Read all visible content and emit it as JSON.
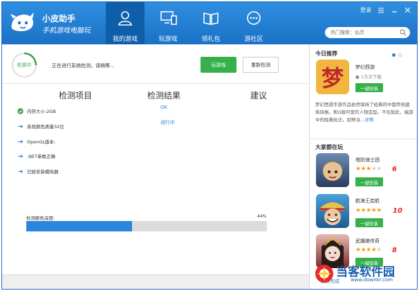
{
  "header": {
    "brand_name": "小皮助手",
    "brand_slogan": "手机游戏电脑玩",
    "nav": [
      {
        "label": "我的游戏",
        "icon": "user-icon",
        "active": true
      },
      {
        "label": "玩游戏",
        "icon": "monitor-phone-icon",
        "active": false
      },
      {
        "label": "领礼包",
        "icon": "book-icon",
        "active": false
      },
      {
        "label": "游社区",
        "icon": "chat-bubble-icon",
        "active": false
      }
    ],
    "login_label": "登录",
    "search_placeholder": "热门搜索：仙灵",
    "colors": {
      "header_bg": "#1a71c6",
      "active_tab": "#0f5ea9"
    }
  },
  "check": {
    "status_label": "检测中",
    "status_message": "正在进行系统检测，请稍等...",
    "play_button": "玩游戏",
    "recheck_button": "重新检测",
    "columns": [
      "检测项目",
      "检测结果",
      "建议"
    ],
    "items": [
      {
        "label": "内存大小:2GB",
        "state": "done",
        "result": "OK"
      },
      {
        "label": "系统颜色质量32位",
        "state": "pending",
        "result": "进行中"
      },
      {
        "label": "OpenGL版本:",
        "state": "pending",
        "result": ""
      },
      {
        "label": ".NET参数正确",
        "state": "pending",
        "result": ""
      },
      {
        "label": "已经安装模拟器",
        "state": "pending",
        "result": ""
      }
    ],
    "progress_label": "检测颜色深度:",
    "progress_text": "44%",
    "progress_value": 0.44,
    "colors": {
      "ok": "#37a14f",
      "accent": "#2b7fd6",
      "progress": "#2c86de"
    }
  },
  "sidebar": {
    "today_title": "今日推荐",
    "featured": {
      "name": "梦幻西游",
      "icon_text": "梦",
      "downloads": "1万次下载",
      "install_label": "一键安装",
      "description": "梦幻西游手游作品依然保持了经典的中国传统建筑风格，和Q版可爱的人物造型。不仅如此，端游中的经典玩法，如帮派",
      "more_label": "详情"
    },
    "playing_title": "大家都在玩",
    "games": [
      {
        "name": "塔防骑士团",
        "rating": 3,
        "score": "6",
        "install_label": "一键安装",
        "icon": "knight-avatar-icon"
      },
      {
        "name": "航海王启航",
        "rating": 5,
        "score": "10",
        "install_label": "一键安装",
        "icon": "pirate-avatar-icon"
      },
      {
        "name": "武媚娘传奇",
        "rating": 4,
        "score": "8",
        "install_label": "一键安装",
        "icon": "empress-avatar-icon"
      }
    ]
  },
  "watermark": {
    "text": "当客软件园",
    "url": "www.downkr.com"
  },
  "footer": {
    "text": "安装完成"
  }
}
